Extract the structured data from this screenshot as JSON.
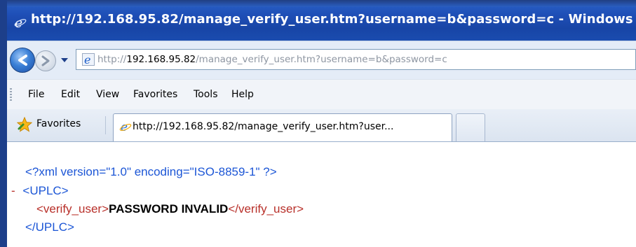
{
  "window": {
    "title": "http://192.168.95.82/manage_verify_user.htm?username=b&password=c - Windows"
  },
  "navigation": {
    "address": {
      "prefix": "http://",
      "host": "192.168.95.82",
      "path": "/manage_verify_user.htm?username=b&password=c"
    }
  },
  "menu": {
    "items": [
      "File",
      "Edit",
      "View",
      "Favorites",
      "Tools",
      "Help"
    ]
  },
  "tabs": {
    "favorites_label": "Favorites",
    "active_tab_label": "http://192.168.95.82/manage_verify_user.htm?user..."
  },
  "content": {
    "xml_declaration": "<?xml version=\"1.0\" encoding=\"ISO-8859-1\" ?>",
    "collapse_marker": "-",
    "root_open": "<UPLC>",
    "child_open": "<verify_user>",
    "child_value": "PASSWORD INVALID",
    "child_close": "</verify_user>",
    "root_close": "</UPLC>"
  },
  "colors": {
    "xml_tag": "#1c56d6",
    "xml_element_name": "#b8302a",
    "title_bar": "#1f4fb7"
  }
}
